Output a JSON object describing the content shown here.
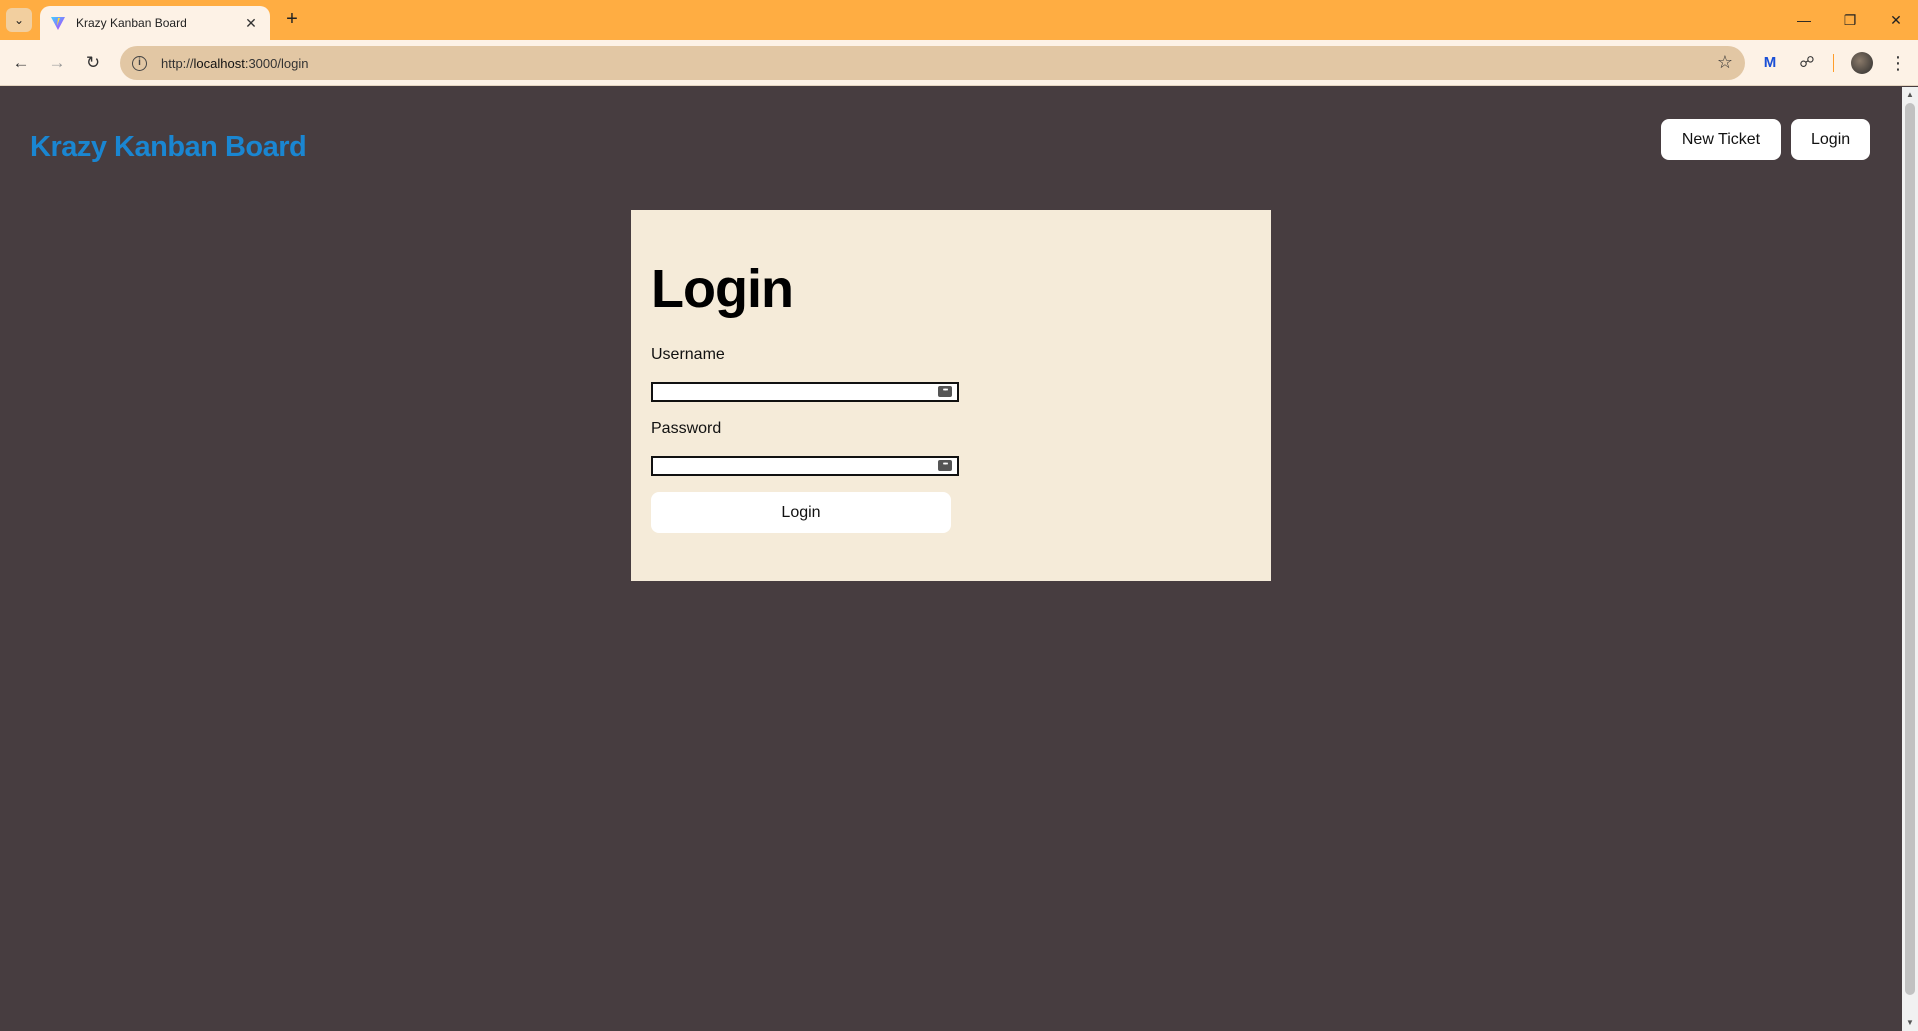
{
  "browser": {
    "tab_title": "Krazy Kanban Board",
    "url_scheme": "http://",
    "url_host": "localhost",
    "url_path": ":3000/login",
    "colors": {
      "tabstrip": "#ffad42",
      "toolbar": "#fdf2e6",
      "omnibox": "#e2c7a4"
    }
  },
  "header": {
    "brand": "Krazy Kanban Board",
    "new_ticket_label": "New Ticket",
    "login_label": "Login",
    "brand_color": "#1a86d1"
  },
  "login_form": {
    "title": "Login",
    "username_label": "Username",
    "username_value": "",
    "password_label": "Password",
    "password_value": "",
    "submit_label": "Login"
  },
  "colors": {
    "page_background": "#473d40",
    "card_background": "#f5ebd9"
  }
}
